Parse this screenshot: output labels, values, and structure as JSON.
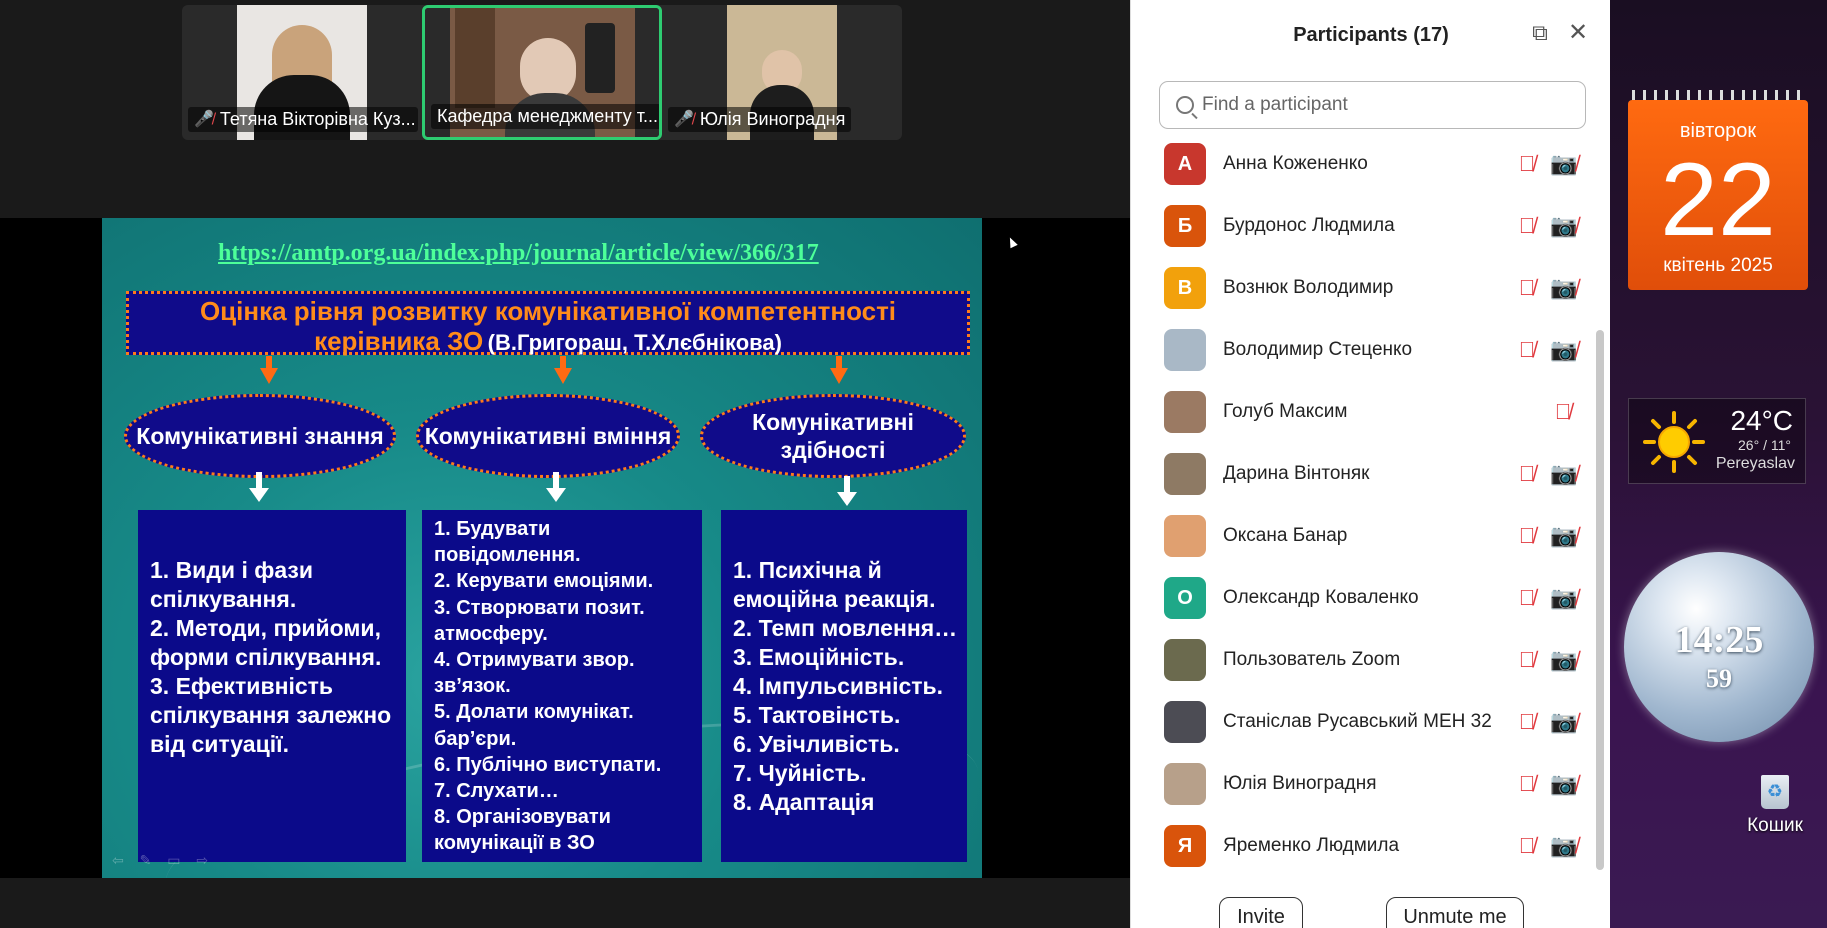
{
  "gallery": {
    "tiles": [
      {
        "name": "Тетяна Вікторівна Куз...",
        "muted": true
      },
      {
        "name": "Кафедра менеджменту т...",
        "muted": false,
        "active_speaker": true
      },
      {
        "name": "Юлія Виноградня",
        "muted": true
      }
    ]
  },
  "slide": {
    "url": "https://amtp.org.ua/index.php/journal/article/view/366/317",
    "title_line1": "Оцінка рівня розвитку комунікативної компетентності",
    "title_line2": "керівника ЗО",
    "title_authors": "(В.Григораш, Т.Хлєбнікова)",
    "columns": [
      {
        "heading": "Комунікативні знання",
        "items": [
          "1.  Види і фази спілкування.",
          "2. Методи, прийоми, форми спілкування.",
          "3. Ефективність спілкування залежно від ситуації."
        ]
      },
      {
        "heading": "Комунікативні вміння",
        "items": [
          "1.   Будувати повідомлення.",
          "2. Керувати емоціями.",
          "3. Створювати позит. атмосферу.",
          "4. Отримувати звор. зв’язок.",
          "5. Долати комунікат. бар’єри.",
          "6. Публічно виступати.",
          "7. Слухати…",
          "8. Організовувати комунікації в ЗО"
        ]
      },
      {
        "heading": "Комунікативні здібності",
        "items": [
          "1.  Психічна й емоційна реакція.",
          "2. Темп мовлення…",
          "3. Емоційність.",
          "4. Імпульсивність.",
          "5. Тактовінсть.",
          "6. Увічливість.",
          "7. Чуйність.",
          "8. Адаптація"
        ]
      }
    ]
  },
  "participants_panel": {
    "title": "Participants (17)",
    "search_placeholder": "Find a participant",
    "participants": [
      {
        "initial": "А",
        "name": "Анна Кожененко",
        "avatar_color": "#c8372d",
        "mic_muted": true,
        "video_off": true
      },
      {
        "initial": "Б",
        "name": "Бурдонос Людмила",
        "avatar_color": "#d9540b",
        "mic_muted": true,
        "video_off": true
      },
      {
        "initial": "В",
        "name": "Вознюк Володимир",
        "avatar_color": "#f2a10c",
        "mic_muted": true,
        "video_off": true
      },
      {
        "initial": "",
        "name": "Володимир Стеценко",
        "avatar_color": "#a9b8c6",
        "mic_muted": true,
        "video_off": true
      },
      {
        "initial": "",
        "name": "Голуб Максим",
        "avatar_color": "#9b7a63",
        "mic_muted": true,
        "video_off": false
      },
      {
        "initial": "",
        "name": "Дарина Вінтоняк",
        "avatar_color": "#8e7a64",
        "mic_muted": true,
        "video_off": true
      },
      {
        "initial": "",
        "name": "Оксана Банар",
        "avatar_color": "#e0a070",
        "mic_muted": true,
        "video_off": true
      },
      {
        "initial": "О",
        "name": "Олександр Коваленко",
        "avatar_color": "#1fa888",
        "mic_muted": true,
        "video_off": true
      },
      {
        "initial": "",
        "name": "Пользователь Zoom",
        "avatar_color": "#6b6a4e",
        "mic_muted": true,
        "video_off": true
      },
      {
        "initial": "",
        "name": "Станіслав Русавський МЕН 32",
        "avatar_color": "#4c4c54",
        "mic_muted": true,
        "video_off": true
      },
      {
        "initial": "",
        "name": "Юлія Виноградня",
        "avatar_color": "#b7a08a",
        "mic_muted": true,
        "video_off": true
      },
      {
        "initial": "Я",
        "name": "Яременко Людмила",
        "avatar_color": "#d9540b",
        "mic_muted": true,
        "video_off": true
      }
    ],
    "invite_label": "Invite",
    "unmute_label": "Unmute me"
  },
  "desktop": {
    "calendar": {
      "weekday": "вівторок",
      "day": "22",
      "month_year": "квітень 2025"
    },
    "weather": {
      "temp": "24°C",
      "range": "26° / 11°",
      "city": "Pereyaslav"
    },
    "clock": {
      "time": "14:25",
      "seconds": "59"
    },
    "recycle_bin_label": "Кошик"
  }
}
